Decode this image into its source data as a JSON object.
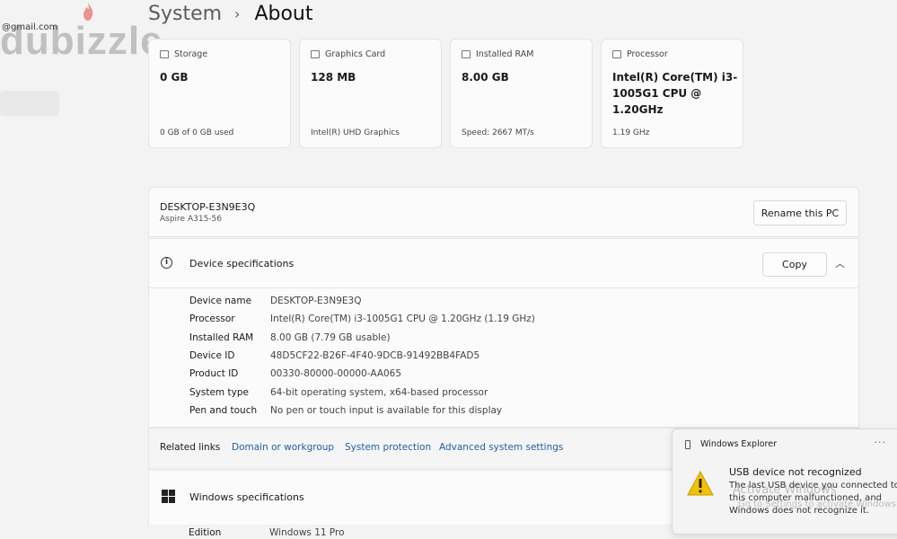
{
  "watermark": {
    "brand": "dubizzle",
    "email": "@gmail.com"
  },
  "breadcrumb": {
    "parent": "System",
    "separator": "›",
    "current": "About"
  },
  "cards": [
    {
      "label": "Storage",
      "value": "0 GB",
      "sub": "0 GB of 0 GB used",
      "icon": "storage-icon"
    },
    {
      "label": "Graphics Card",
      "value": "128 MB",
      "sub": "Intel(R) UHD Graphics",
      "icon": "graphics-card-icon"
    },
    {
      "label": "Installed RAM",
      "value": "8.00 GB",
      "sub": "Speed: 2667 MT/s",
      "icon": "ram-icon"
    },
    {
      "label": "Processor",
      "value": "Intel(R) Core(TM) i3-1005G1 CPU @ 1.20GHz",
      "sub": "1.19 GHz",
      "icon": "processor-icon"
    }
  ],
  "pc": {
    "name": "DESKTOP-E3N9E3Q",
    "model": "Aspire A315-56",
    "rename_label": "Rename this PC"
  },
  "device_specs": {
    "title": "Device specifications",
    "copy_label": "Copy",
    "rows": [
      {
        "key": "Device name",
        "value": "DESKTOP-E3N9E3Q"
      },
      {
        "key": "Processor",
        "value": "Intel(R) Core(TM) i3-1005G1 CPU @ 1.20GHz (1.19 GHz)"
      },
      {
        "key": "Installed RAM",
        "value": "8.00 GB (7.79 GB usable)"
      },
      {
        "key": "Device ID",
        "value": "48D5CF22-B26F-4F40-9DCB-91492BB4FAD5"
      },
      {
        "key": "Product ID",
        "value": "00330-80000-00000-AA065"
      },
      {
        "key": "System type",
        "value": "64-bit operating system, x64-based processor"
      },
      {
        "key": "Pen and touch",
        "value": "No pen or touch input is available for this display"
      }
    ]
  },
  "related_links": {
    "label": "Related links",
    "links": [
      "Domain or workgroup",
      "System protection",
      "Advanced system settings"
    ]
  },
  "windows_specs": {
    "title": "Windows specifications",
    "edition_key": "Edition",
    "edition_value": "Windows 11 Pro"
  },
  "toast": {
    "app": "Windows Explorer",
    "more": "···",
    "title": "USB device not recognized",
    "body": "The last USB device you connected to this computer malfunctioned, and Windows does not recognize it."
  },
  "activation": {
    "title": "Activate Windows",
    "sub": "Go to Settings to activate Windows."
  },
  "colors": {
    "link": "#1f5fa8",
    "warning": "#f2c200",
    "background": "#f3f3f3"
  }
}
